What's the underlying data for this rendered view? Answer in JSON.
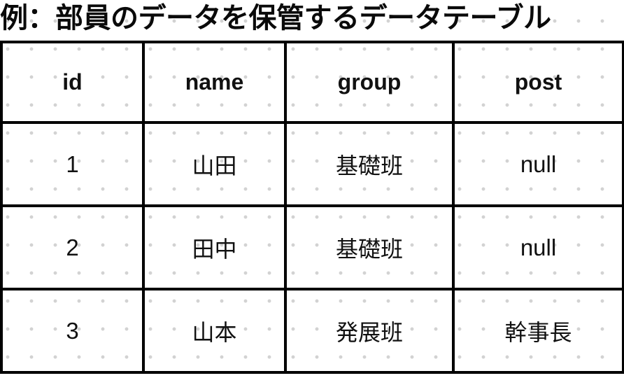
{
  "title": "例：部員のデータを保管するデータテーブル",
  "table": {
    "headers": [
      "id",
      "name",
      "group",
      "post"
    ],
    "rows": [
      [
        "1",
        "山田",
        "基礎班",
        "null"
      ],
      [
        "2",
        "田中",
        "基礎班",
        "null"
      ],
      [
        "3",
        "山本",
        "発展班",
        "幹事長"
      ]
    ]
  }
}
